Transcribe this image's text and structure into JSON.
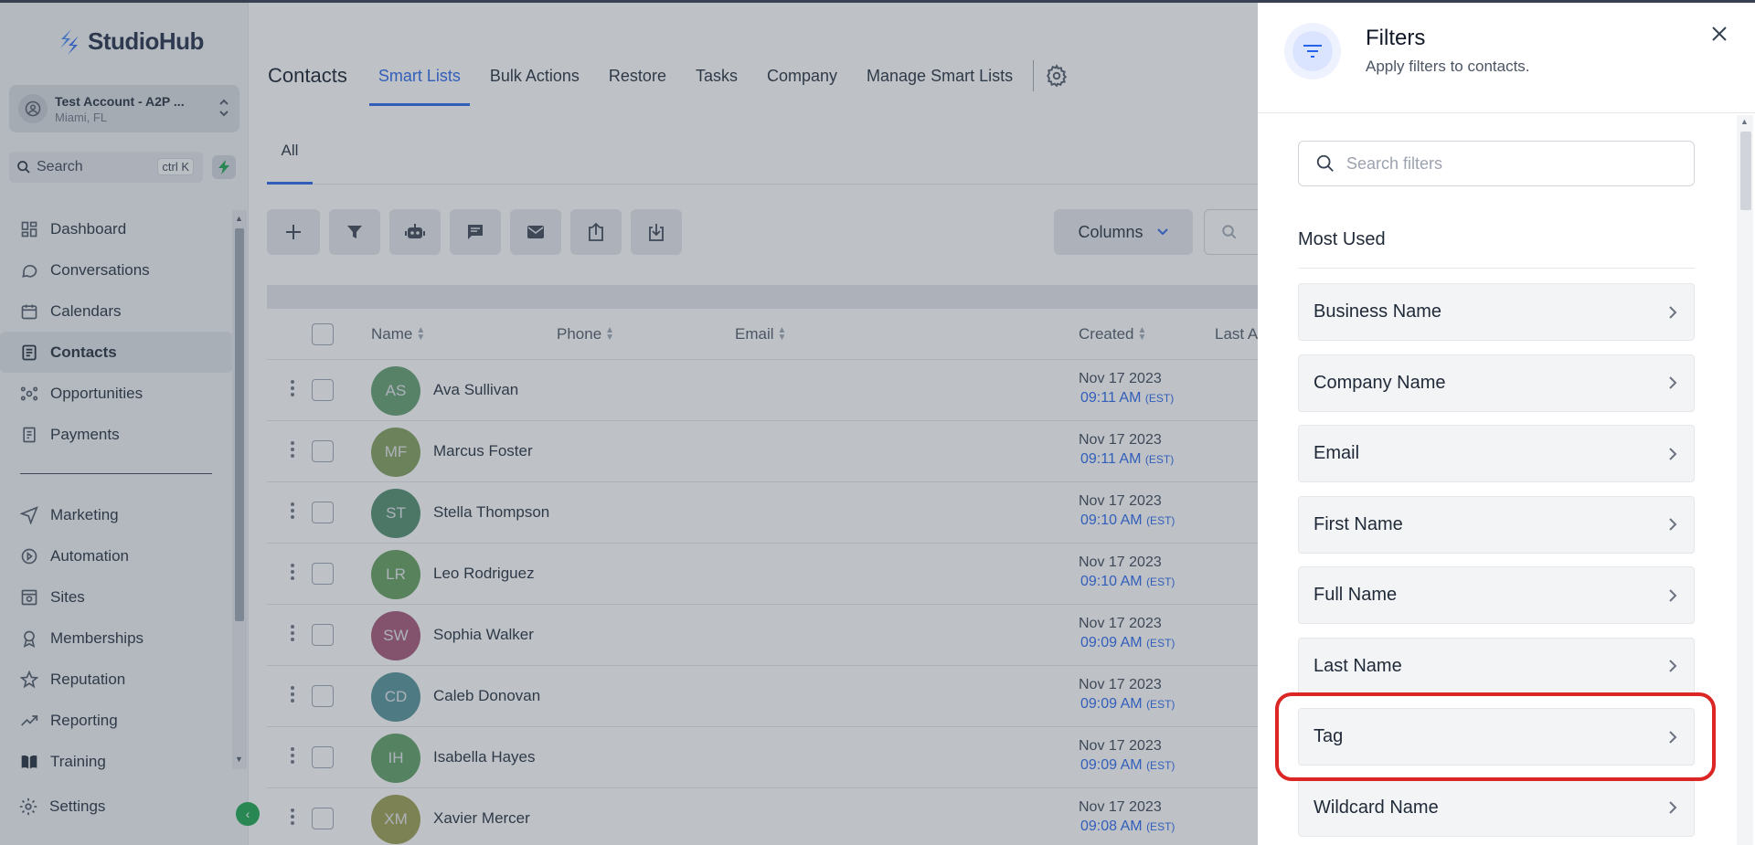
{
  "app": {
    "name": "StudioHub"
  },
  "account": {
    "name": "Test Account - A2P ...",
    "location": "Miami, FL"
  },
  "sidebar": {
    "search_label": "Search",
    "search_shortcut": "ctrl K",
    "items": [
      {
        "label": "Dashboard",
        "icon": "dashboard-icon"
      },
      {
        "label": "Conversations",
        "icon": "chat-icon"
      },
      {
        "label": "Calendars",
        "icon": "calendar-icon"
      },
      {
        "label": "Contacts",
        "icon": "contacts-icon",
        "active": true
      },
      {
        "label": "Opportunities",
        "icon": "opportunities-icon"
      },
      {
        "label": "Payments",
        "icon": "payments-icon"
      }
    ],
    "items2": [
      {
        "label": "Marketing",
        "icon": "send-icon"
      },
      {
        "label": "Automation",
        "icon": "automation-icon"
      },
      {
        "label": "Sites",
        "icon": "sites-icon"
      },
      {
        "label": "Memberships",
        "icon": "memberships-icon"
      },
      {
        "label": "Reputation",
        "icon": "star-icon"
      },
      {
        "label": "Reporting",
        "icon": "reporting-icon"
      },
      {
        "label": "Training",
        "icon": "book-icon"
      }
    ],
    "settings_label": "Settings"
  },
  "topnav": {
    "title": "Contacts",
    "tabs": [
      "Smart Lists",
      "Bulk Actions",
      "Restore",
      "Tasks",
      "Company",
      "Manage Smart Lists"
    ],
    "active_tab": "Smart Lists"
  },
  "subtabs": {
    "all": "All"
  },
  "toolbar": {
    "columns_label": "Columns"
  },
  "table": {
    "headers": {
      "name": "Name",
      "phone": "Phone",
      "email": "Email",
      "created": "Created",
      "last_activity": "Last Acti"
    },
    "rows": [
      {
        "initials": "AS",
        "name": "Ava Sullivan",
        "date": "Nov 17 2023",
        "time": "09:11 AM",
        "tz": "(EST)",
        "color": "#5f9b6a"
      },
      {
        "initials": "MF",
        "name": "Marcus Foster",
        "date": "Nov 17 2023",
        "time": "09:11 AM",
        "tz": "(EST)",
        "color": "#7f9c56"
      },
      {
        "initials": "ST",
        "name": "Stella Thompson",
        "date": "Nov 17 2023",
        "time": "09:10 AM",
        "tz": "(EST)",
        "color": "#4d8a6a"
      },
      {
        "initials": "LR",
        "name": "Leo Rodriguez",
        "date": "Nov 17 2023",
        "time": "09:10 AM",
        "tz": "(EST)",
        "color": "#5f9b57"
      },
      {
        "initials": "SW",
        "name": "Sophia Walker",
        "date": "Nov 17 2023",
        "time": "09:09 AM",
        "tz": "(EST)",
        "color": "#a35273"
      },
      {
        "initials": "CD",
        "name": "Caleb Donovan",
        "date": "Nov 17 2023",
        "time": "09:09 AM",
        "tz": "(EST)",
        "color": "#4f8f95"
      },
      {
        "initials": "IH",
        "name": "Isabella Hayes",
        "date": "Nov 17 2023",
        "time": "09:09 AM",
        "tz": "(EST)",
        "color": "#5c9b5e"
      },
      {
        "initials": "XM",
        "name": "Xavier Mercer",
        "date": "Nov 17 2023",
        "time": "09:08 AM",
        "tz": "(EST)",
        "color": "#9a9c4c"
      }
    ]
  },
  "filters_panel": {
    "title": "Filters",
    "subtitle": "Apply filters to contacts.",
    "search_placeholder": "Search filters",
    "section_title": "Most Used",
    "items": [
      "Business Name",
      "Company Name",
      "Email",
      "First Name",
      "Full Name",
      "Last Name",
      "Tag",
      "Wildcard Name"
    ],
    "highlighted_item": "Tag",
    "highlight_color": "#dc2626"
  },
  "colors": {
    "accent": "#2563eb",
    "brand_green": "#16a34a"
  }
}
